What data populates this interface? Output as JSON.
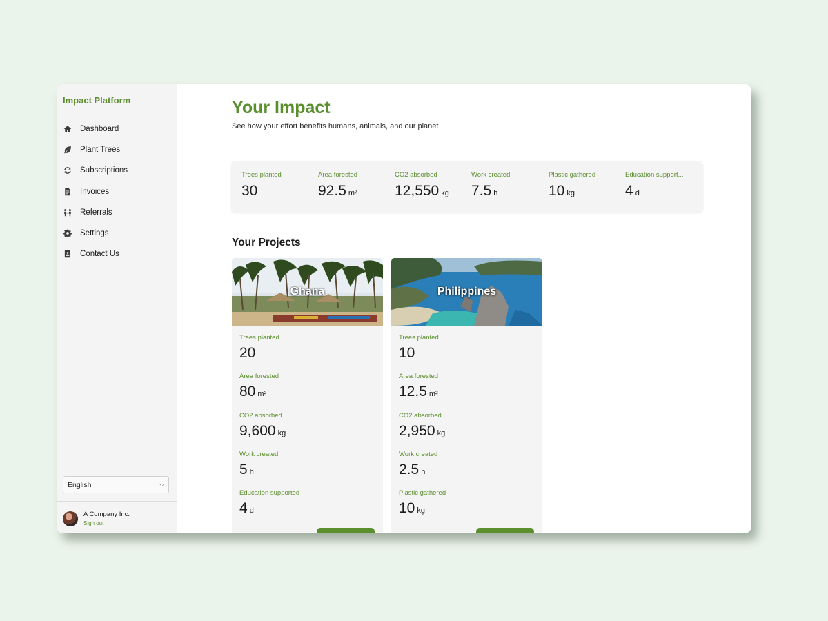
{
  "sidebar": {
    "brand": "Impact Platform",
    "items": [
      {
        "label": "Dashboard",
        "icon": "home-icon"
      },
      {
        "label": "Plant Trees",
        "icon": "leaf-icon"
      },
      {
        "label": "Subscriptions",
        "icon": "refresh-icon"
      },
      {
        "label": "Invoices",
        "icon": "document-icon"
      },
      {
        "label": "Referrals",
        "icon": "people-icon"
      },
      {
        "label": "Settings",
        "icon": "gear-icon"
      },
      {
        "label": "Contact Us",
        "icon": "contact-book-icon"
      }
    ],
    "language": "English",
    "user": {
      "name": "A Company Inc.",
      "sign_out": "Sign out"
    }
  },
  "main": {
    "title": "Your Impact",
    "subtitle": "See how your effort benefits humans, animals, and our planet",
    "stats": [
      {
        "label": "Trees planted",
        "value": "30",
        "unit": ""
      },
      {
        "label": "Area forested",
        "value": "92.5",
        "unit": "m²"
      },
      {
        "label": "CO2 absorbed",
        "value": "12,550",
        "unit": "kg"
      },
      {
        "label": "Work created",
        "value": "7.5",
        "unit": "h"
      },
      {
        "label": "Plastic gathered",
        "value": "10",
        "unit": "kg"
      },
      {
        "label": "Education support...",
        "value": "4",
        "unit": "d"
      }
    ],
    "projects_title": "Your Projects",
    "projects": [
      {
        "name": "Ghana",
        "metrics": [
          {
            "label": "Trees planted",
            "value": "20",
            "unit": ""
          },
          {
            "label": "Area forested",
            "value": "80",
            "unit": "m²"
          },
          {
            "label": "CO2 absorbed",
            "value": "9,600",
            "unit": "kg"
          },
          {
            "label": "Work created",
            "value": "5",
            "unit": "h"
          },
          {
            "label": "Education supported",
            "value": "4",
            "unit": "d"
          }
        ]
      },
      {
        "name": "Philippines",
        "metrics": [
          {
            "label": "Trees planted",
            "value": "10",
            "unit": ""
          },
          {
            "label": "Area forested",
            "value": "12.5",
            "unit": "m²"
          },
          {
            "label": "CO2 absorbed",
            "value": "2,950",
            "unit": "kg"
          },
          {
            "label": "Work created",
            "value": "2.5",
            "unit": "h"
          },
          {
            "label": "Plastic gathered",
            "value": "10",
            "unit": "kg"
          }
        ]
      }
    ]
  },
  "colors": {
    "accent": "#5b8f2e",
    "page_background": "#ebf4ea",
    "sidebar_background": "#f4f4f4"
  }
}
